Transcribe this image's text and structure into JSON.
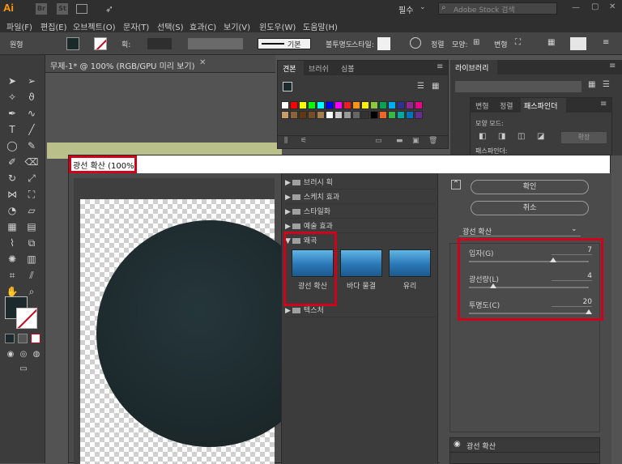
{
  "app": {
    "logo": "Ai",
    "icon_br": "Br",
    "icon_st": "St",
    "workspace": "필수",
    "stock_search_placeholder": "Adobe Stock 검색"
  },
  "menu": [
    "파일(F)",
    "편집(E)",
    "오브젝트(O)",
    "문자(T)",
    "선택(S)",
    "효과(C)",
    "보기(V)",
    "윈도우(W)",
    "도움말(H)"
  ],
  "control_bar": {
    "selection_label": "원형",
    "stroke_label": "획:",
    "stroke_style": "기본",
    "opacity_label": "불투명도",
    "style_label": "스타일:",
    "align_label": "정렬",
    "shape_label": "모양:",
    "transform_label": "변형"
  },
  "document": {
    "tab_title": "무제-1* @ 100% (RGB/GPU 미리 보기)"
  },
  "panels": {
    "swatch_tabs": [
      "견본",
      "브러쉬",
      "심볼"
    ],
    "library_tab": "라이브러리",
    "pathfinder_tabs": [
      "변형",
      "정렬",
      "패스파인더"
    ],
    "shape_mode_label": "모양 모드:",
    "expand_label": "확장",
    "pathfinder_label": "패스파인더:"
  },
  "dialog": {
    "title": "광선 확산 (100%)",
    "folders": [
      "브러시 획",
      "스케치 효과",
      "스타일화",
      "예술 효과",
      "왜곡",
      "텍스처"
    ],
    "open_folder": "왜곡",
    "thumbnails": [
      {
        "label": "광선 확산",
        "selected": true
      },
      {
        "label": "바다 물결",
        "selected": false
      },
      {
        "label": "유리",
        "selected": false
      }
    ],
    "ok_label": "확인",
    "cancel_label": "취소",
    "filter_select": "광선 확산",
    "sliders": [
      {
        "label": "입자(G)",
        "value": 7,
        "fraction": 0.7
      },
      {
        "label": "광선량(L)",
        "value": 4,
        "fraction": 0.2
      },
      {
        "label": "투명도(C)",
        "value": 20,
        "fraction": 1.0
      }
    ],
    "layer_name": "광선 확산"
  },
  "colors": {
    "accent_highlight": "#d0021b",
    "ai_orange": "#ff9a00",
    "circle_fill": "#1d2a2d"
  }
}
